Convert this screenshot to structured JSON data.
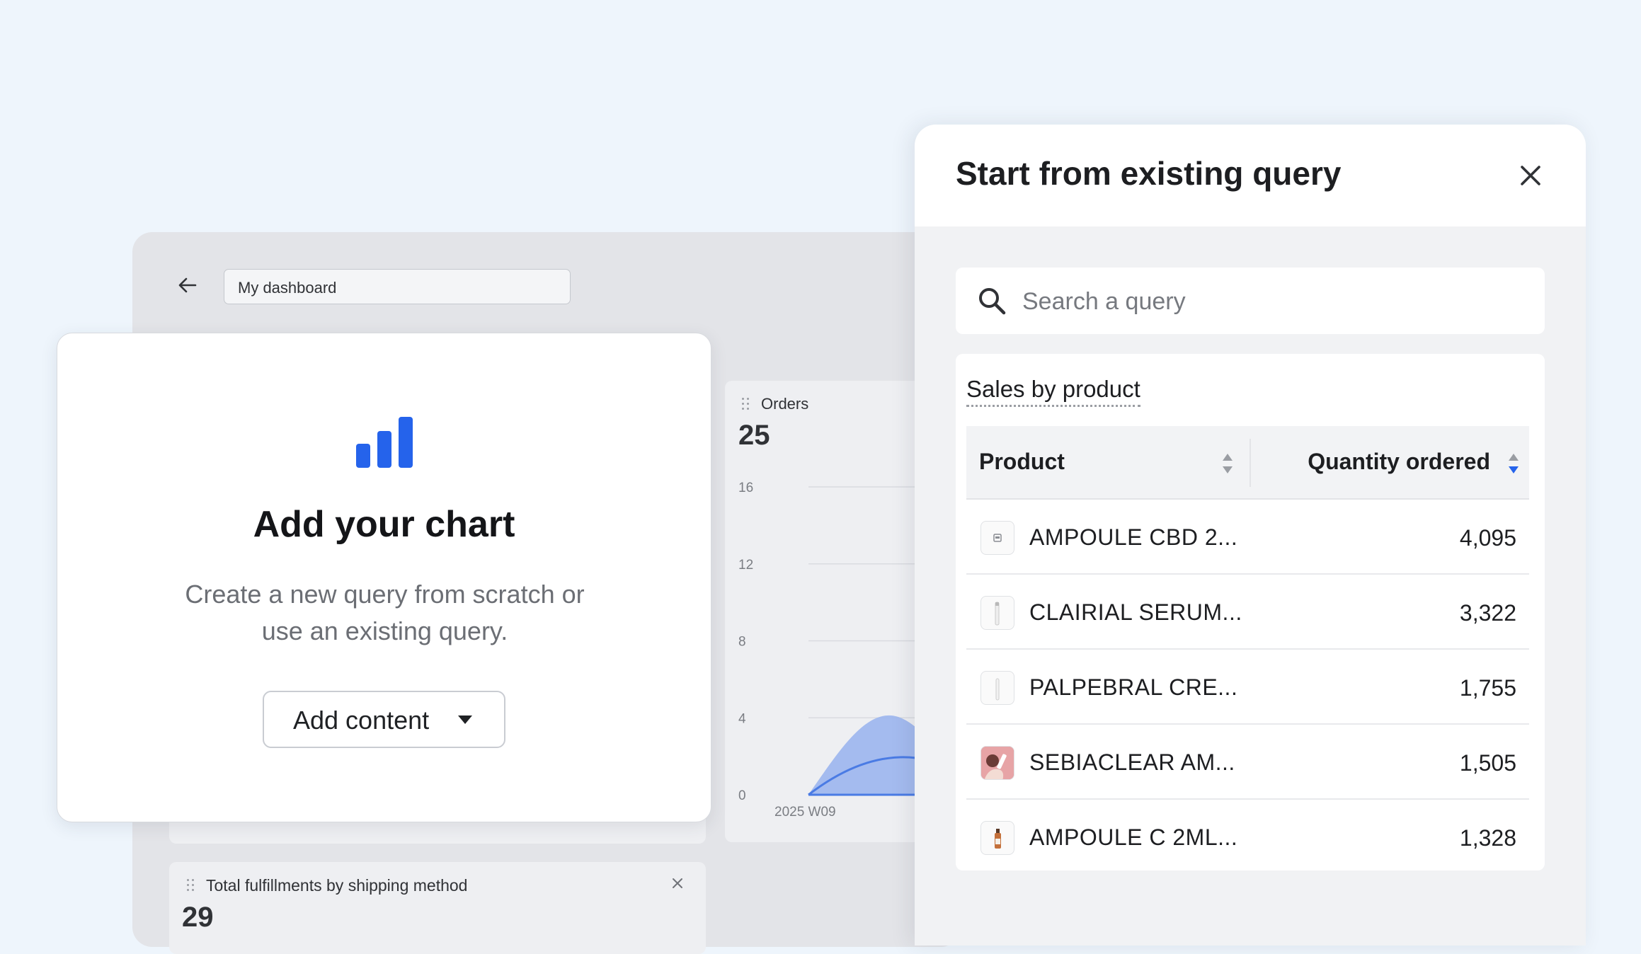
{
  "dashboard": {
    "title": "My dashboard"
  },
  "orders_card": {
    "label": "Orders",
    "value": "25"
  },
  "chart_data": {
    "type": "area",
    "title": "Orders",
    "x": [
      "2025 W09"
    ],
    "y_ticks": [
      0,
      4,
      8,
      12,
      16
    ],
    "ylim": [
      0,
      16
    ],
    "grid": true,
    "colors": [
      "#9bb5ee",
      "#4a7be4"
    ]
  },
  "fulfillments_card": {
    "label": "Total fulfillments by shipping method",
    "value": "29"
  },
  "add_chart": {
    "title": "Add your chart",
    "description": "Create a new query from scratch or use an existing query.",
    "button_label": "Add content",
    "icon_color": "#2563eb"
  },
  "modal": {
    "title": "Start from existing query",
    "search_placeholder": "Search a query",
    "result_title": "Sales by product",
    "columns": [
      "Product",
      "Quantity ordered"
    ],
    "rows": [
      {
        "product": "AMPOULE CBD 2...",
        "quantity": "4,095",
        "icon": "box-product-icon"
      },
      {
        "product": "CLAIRIAL SERUM...",
        "quantity": "3,322",
        "icon": "tube-product-icon"
      },
      {
        "product": "PALPEBRAL CRE...",
        "quantity": "1,755",
        "icon": "tube-product-icon"
      },
      {
        "product": "SEBIACLEAR AM...",
        "quantity": "1,505",
        "icon": "photo-product-icon"
      },
      {
        "product": "AMPOULE C 2ML...",
        "quantity": "1,328",
        "icon": "bottle-product-icon"
      }
    ]
  }
}
